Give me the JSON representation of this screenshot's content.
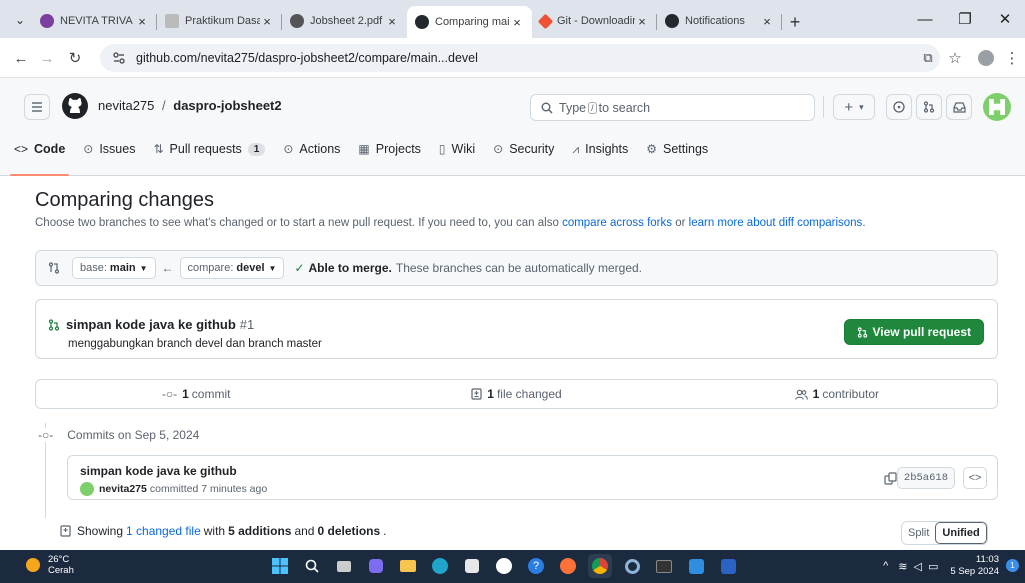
{
  "browser": {
    "tabs": [
      {
        "title": "NEVITA TRIVA YULI",
        "icon": "circle-favicon",
        "color": "#7b3fa0"
      },
      {
        "title": "Praktikum Dasar P",
        "icon": "doc-favicon",
        "color": "#888888"
      },
      {
        "title": "Jobsheet 2.pdf",
        "icon": "edge-pdf-favicon",
        "color": "#555555"
      },
      {
        "title": "Comparing main...",
        "icon": "github-favicon",
        "color": "#24292f",
        "active": true
      },
      {
        "title": "Git - Downloading",
        "icon": "git-favicon",
        "color": "#f05133"
      },
      {
        "title": "Notifications",
        "icon": "github-favicon",
        "color": "#24292f"
      }
    ],
    "url": "github.com/nevita275/daspro-jobsheet2/compare/main...devel"
  },
  "header": {
    "owner": "nevita275",
    "separator": "/",
    "repo": "daspro-jobsheet2",
    "search_prefix": "Type",
    "search_key": "/",
    "search_suffix": "to search",
    "plus_label": "+",
    "caret": "▾"
  },
  "repo_nav": [
    {
      "label": "Code",
      "icon": "code-icon",
      "glyph": "<>",
      "active": true
    },
    {
      "label": "Issues",
      "icon": "issue-icon",
      "glyph": "⊙"
    },
    {
      "label": "Pull requests",
      "icon": "pull-request-icon",
      "glyph": "⇅",
      "count": "1"
    },
    {
      "label": "Actions",
      "icon": "play-icon",
      "glyph": "⊙"
    },
    {
      "label": "Projects",
      "icon": "table-icon",
      "glyph": "▦"
    },
    {
      "label": "Wiki",
      "icon": "book-icon",
      "glyph": "▯"
    },
    {
      "label": "Security",
      "icon": "shield-icon",
      "glyph": "⊙"
    },
    {
      "label": "Insights",
      "icon": "graph-icon",
      "glyph": "⩘"
    },
    {
      "label": "Settings",
      "icon": "gear-icon",
      "glyph": "⚙"
    }
  ],
  "compare": {
    "title": "Comparing changes",
    "subtitle_text": "Choose two branches to see what's changed or to start a new pull request. If you need to, you can also",
    "link_forks": "compare across forks",
    "or": "or",
    "link_learn": "learn more about diff comparisons",
    "period": ".",
    "base_label": "base:",
    "base_value": "main",
    "compare_label": "compare:",
    "compare_value": "devel",
    "arrow": "←",
    "able": "Able to merge.",
    "able_msg": "These branches can be automatically merged."
  },
  "pr": {
    "title": "simpan kode java ke github",
    "number": "#1",
    "description": "menggabungkan branch devel dan branch master",
    "button": "View pull request"
  },
  "stats": {
    "commits_num": "1",
    "commits_label": "commit",
    "files_num": "1",
    "files_label": "file changed",
    "contrib_num": "1",
    "contrib_label": "contributor"
  },
  "commits": {
    "heading": "Commits on Sep 5, 2024",
    "message": "simpan kode java ke github",
    "author": "nevita275",
    "when": "committed 7 minutes ago",
    "sha": "2b5a618",
    "browse": "<>"
  },
  "diff": {
    "showing": "Showing",
    "changed_files": "1 changed file",
    "with": "with",
    "additions": "5 additions",
    "and": "and",
    "deletions": "0 deletions",
    "period": ".",
    "split": "Split",
    "unified": "Unified"
  },
  "taskbar": {
    "temp": "26°C",
    "weather": "Cerah",
    "time": "11:03",
    "date": "5 Sep 2024",
    "notif": "1"
  },
  "colors": {
    "green": "#1f883d",
    "link": "#0969da",
    "tab_underline": "#fd8c73"
  }
}
